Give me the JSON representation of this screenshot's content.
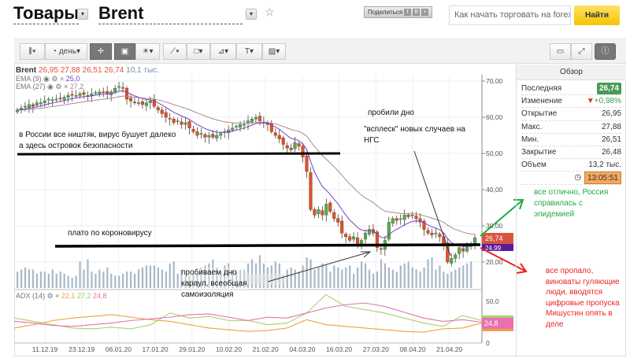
{
  "header": {
    "category": "Товары",
    "instrument": "Brent",
    "share_label": "Поделиться",
    "share_icons": [
      "f",
      "B",
      "+"
    ],
    "search_value": "Как начать торговать на forex",
    "search_button": "Найти"
  },
  "toolbar": {
    "interval": "день"
  },
  "legend": {
    "symbol": "Brent",
    "open": "26,95",
    "high": "27,88",
    "low": "26,51",
    "close": "26,74",
    "volume": "10,1 тыс.",
    "ema9_label": "EMA (9)",
    "ema9_value": "25,0",
    "ema27_label": "EMA (27)",
    "ema27_value": "27,2",
    "adx_label": "ADX (14)",
    "adx_values": [
      "22,1",
      "27,2",
      "24,8"
    ]
  },
  "overview": {
    "title": "Обзор",
    "rows": [
      {
        "label": "Последняя",
        "value": "26,74"
      },
      {
        "label": "Изменение",
        "value": "+0,98%"
      },
      {
        "label": "Открытие",
        "value": "26,95"
      },
      {
        "label": "Макс.",
        "value": "27,88"
      },
      {
        "label": "Мин.",
        "value": "26,51"
      },
      {
        "label": "Закрытие",
        "value": "26,48"
      },
      {
        "label": "Объем",
        "value": "13,2 тыс."
      }
    ],
    "time": "13:05:51"
  },
  "price_axis": [
    "70,00",
    "60,00",
    "50,00",
    "40,00",
    "30,00",
    "20,00"
  ],
  "adx_axis": [
    "50,0",
    "0"
  ],
  "price_tags": {
    "last": "26,74",
    "ema": "24,99",
    "adx": "24,8"
  },
  "dates": [
    "11.12.19",
    "23.12.19",
    "06.01.20",
    "17.01.20",
    "29.01.20",
    "10.02.20",
    "21.02.20",
    "04.03.20",
    "16.03.20",
    "27.03.20",
    "08.04.20",
    "21.04.20"
  ],
  "annotations": {
    "russia_ok": [
      "в России все ништяк, вирус бушует далеко",
      "а здесь островок безопасности"
    ],
    "plateau": "плато по короновирусу",
    "bottom_broken": "пробили дно",
    "surge": [
      "\"всплеск\" новых случаев на",
      "НГС"
    ],
    "breaking": [
      "пробиваем дно",
      "караул, всеобщая",
      "самоизоляция"
    ],
    "good": [
      "все отлично, Россия",
      "справилась с",
      "эпидемией"
    ],
    "bad": [
      "все пропало,",
      "виноваты гуляющие",
      "люди, вводятся",
      "цифровые пропуска",
      "Мишустин опять в",
      "деле"
    ]
  },
  "colors": {
    "up": "#5aa85a",
    "down": "#d9542e",
    "ema9": "#7b3fc0",
    "ema27": "#a88a8a",
    "adx": "#f0a040",
    "di_plus": "#a8d070",
    "di_minus": "#e870b0",
    "good": "#22aa44",
    "bad": "#ee2222"
  },
  "chart_data": {
    "type": "candlestick",
    "closes": [
      62,
      62.5,
      63,
      63.5,
      63,
      64,
      64,
      64.5,
      65,
      64.8,
      65,
      65.2,
      65.5,
      66,
      66.2,
      66,
      66.5,
      66.3,
      66,
      66.5,
      66.8,
      67,
      66.8,
      66.5,
      67,
      68,
      68.5,
      68,
      65,
      64.5,
      64,
      64,
      63.5,
      64,
      64.5,
      63,
      62,
      61,
      60,
      59.5,
      58.5,
      59,
      58,
      58.5,
      57,
      56,
      55,
      55.5,
      54.5,
      55,
      54.5,
      55,
      55.5,
      56,
      56.5,
      57,
      57.5,
      58,
      58,
      59,
      59.5,
      60,
      59,
      58.5,
      58,
      56,
      55,
      54,
      52.5,
      51.5,
      51,
      53,
      52,
      49,
      45,
      34.5,
      33,
      34.5,
      33,
      36,
      34,
      32,
      31,
      28,
      27,
      26,
      27,
      25,
      26,
      28,
      29,
      28,
      24,
      23.5,
      26,
      31,
      32,
      31.5,
      32,
      33,
      32.5,
      33,
      32,
      31,
      29,
      28,
      27.5,
      28,
      27,
      25,
      20,
      21,
      22,
      24,
      23,
      24,
      25,
      26.7
    ],
    "volumes": [
      8,
      9,
      10,
      9,
      9,
      7,
      8,
      8,
      7,
      9,
      7,
      8,
      7,
      6,
      5,
      6,
      13,
      9,
      14,
      8,
      7,
      9,
      8,
      10,
      7,
      6,
      6,
      7,
      8,
      8,
      7,
      9,
      10,
      11,
      11,
      11,
      10,
      9,
      8,
      12,
      13,
      7,
      9,
      6,
      6,
      7,
      7,
      10,
      11,
      12,
      14,
      10,
      8,
      11,
      12,
      9,
      8,
      9,
      9,
      12,
      14,
      12,
      16,
      12,
      10,
      11,
      13,
      12,
      6,
      9,
      10,
      9,
      8,
      11,
      15,
      14,
      9,
      10,
      12,
      11,
      8,
      11,
      10,
      9,
      10,
      11,
      7,
      10,
      13,
      12,
      9,
      7,
      8,
      14,
      12,
      10,
      9,
      8,
      11,
      12,
      13,
      10,
      9,
      8,
      10,
      14,
      15,
      9,
      11,
      8,
      7,
      8,
      9,
      10,
      11,
      12,
      13
    ],
    "adx": [
      18,
      22,
      27,
      30,
      32,
      34,
      31,
      28,
      26,
      22,
      18,
      16,
      14,
      15,
      18,
      28,
      22,
      20,
      18,
      16,
      14,
      13,
      17,
      18,
      24
    ],
    "di_plus": [
      30,
      26,
      22,
      18,
      17,
      19,
      17,
      22,
      36,
      30,
      32,
      27,
      27,
      22,
      24,
      36,
      58,
      44,
      40,
      36,
      30,
      24,
      20,
      33,
      27
    ],
    "di_minus": [
      26,
      24,
      21,
      20,
      22,
      24,
      27,
      29,
      31,
      34,
      35,
      31,
      27,
      31,
      30,
      36,
      42,
      46,
      48,
      44,
      37,
      30,
      26,
      28,
      25
    ],
    "price_range": [
      15,
      73
    ],
    "adx_range": [
      0,
      60
    ]
  }
}
